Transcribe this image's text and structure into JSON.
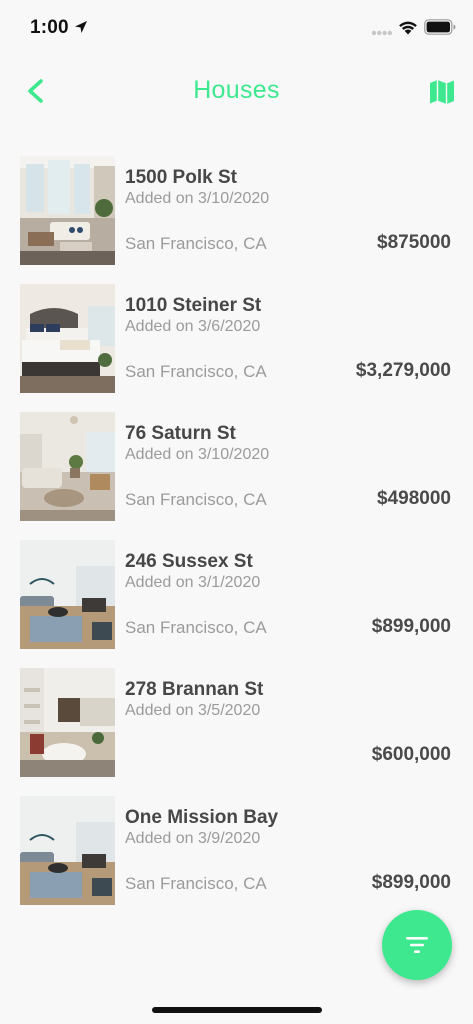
{
  "status_bar": {
    "time": "1:00",
    "icons": [
      "location-arrow-icon",
      "signal-dots-icon",
      "wifi-icon",
      "battery-icon"
    ]
  },
  "nav": {
    "title": "Houses",
    "back_icon": "chevron-left-icon",
    "map_icon": "map-icon"
  },
  "colors": {
    "accent": "#3ee88f",
    "background": "#f8f8f8",
    "title_text": "#474747",
    "secondary_text": "#9b9b9b"
  },
  "listings": [
    {
      "address": "1500 Polk St",
      "added": "Added on 3/10/2020",
      "city": "San Francisco, CA",
      "price": "$875000"
    },
    {
      "address": "1010 Steiner St",
      "added": "Added on 3/6/2020",
      "city": "San Francisco, CA",
      "price": "$3,279,000"
    },
    {
      "address": "76 Saturn St",
      "added": "Added on 3/10/2020",
      "city": "San Francisco, CA",
      "price": "$498000"
    },
    {
      "address": "246 Sussex St",
      "added": "Added on 3/1/2020",
      "city": "San Francisco, CA",
      "price": "$899,000"
    },
    {
      "address": "278 Brannan St",
      "added": "Added on 3/5/2020",
      "city": "",
      "price": "$600,000"
    },
    {
      "address": "One Mission Bay",
      "added": "Added on 3/9/2020",
      "city": "San Francisco, CA",
      "price": "$899,000"
    }
  ],
  "fab": {
    "icon": "filter-icon"
  }
}
